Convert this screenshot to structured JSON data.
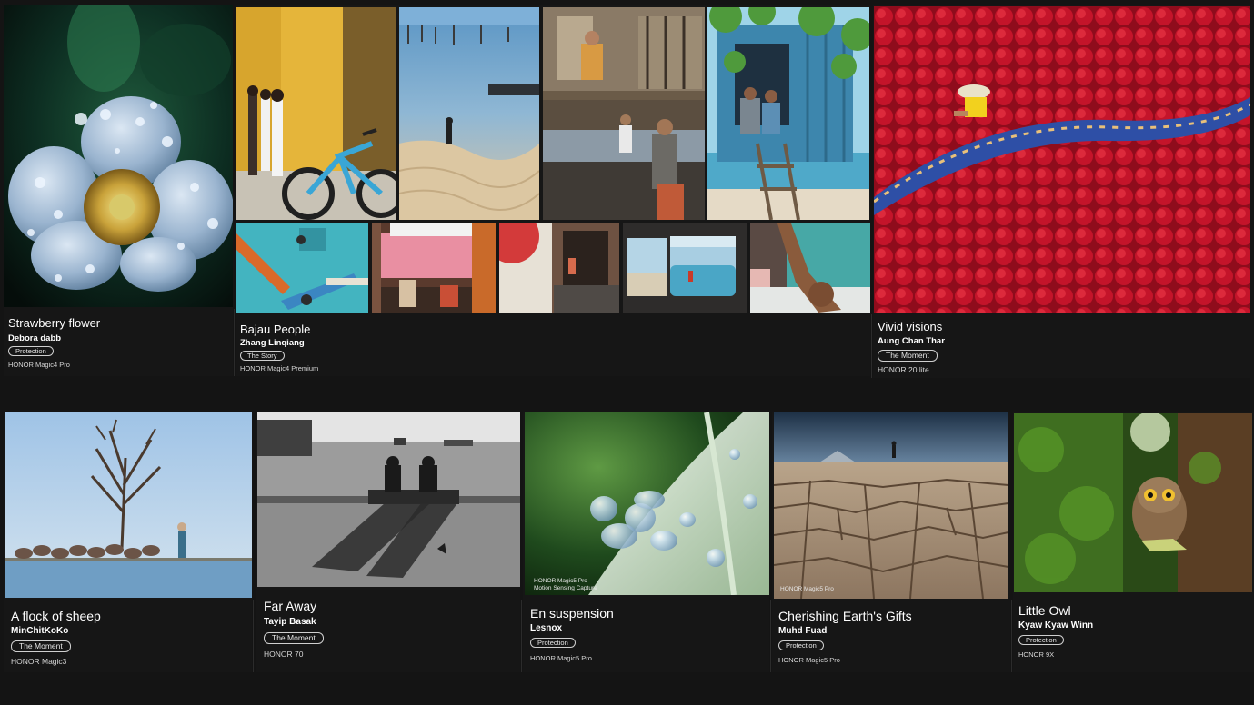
{
  "colors": {
    "background": "#141414",
    "tag_border": "#cfcfcf",
    "text_primary": "#ffffff",
    "text_secondary": "#d6d6d6"
  },
  "row1": [
    {
      "title": "Strawberry flower",
      "author": "Debora dabb",
      "tag": "Protection",
      "device": "HONOR Magic4 Pro"
    },
    {
      "title": "Bajau People",
      "author": "Zhang Linqiang",
      "tag": "The Story",
      "device": "HONOR Magic4 Premium"
    },
    {
      "title": "Vivid visions",
      "author": "Aung Chan Thar",
      "tag": "The Moment",
      "device": "HONOR 20 lite"
    }
  ],
  "row2": [
    {
      "title": "A flock of sheep",
      "author": "MinChitKoKo",
      "tag": "The Moment",
      "device": "HONOR Magic3"
    },
    {
      "title": "Far Away",
      "author": "Tayip Basak",
      "tag": "The Moment",
      "device": "HONOR 70"
    },
    {
      "title": "En suspension",
      "author": "Lesnox",
      "tag": "Protection",
      "device": "HONOR Magic5 Pro",
      "watermark": [
        "HONOR Magic5 Pro",
        "Motion Sensing Capture"
      ]
    },
    {
      "title": "Cherishing Earth's Gifts",
      "author": "Muhd Fuad",
      "tag": "Protection",
      "device": "HONOR Magic5 Pro",
      "watermark": "HONOR Magic5 Pro"
    },
    {
      "title": "Little Owl",
      "author": "Kyaw Kyaw Winn",
      "tag": "Protection",
      "device": "HONOR 9X"
    }
  ]
}
